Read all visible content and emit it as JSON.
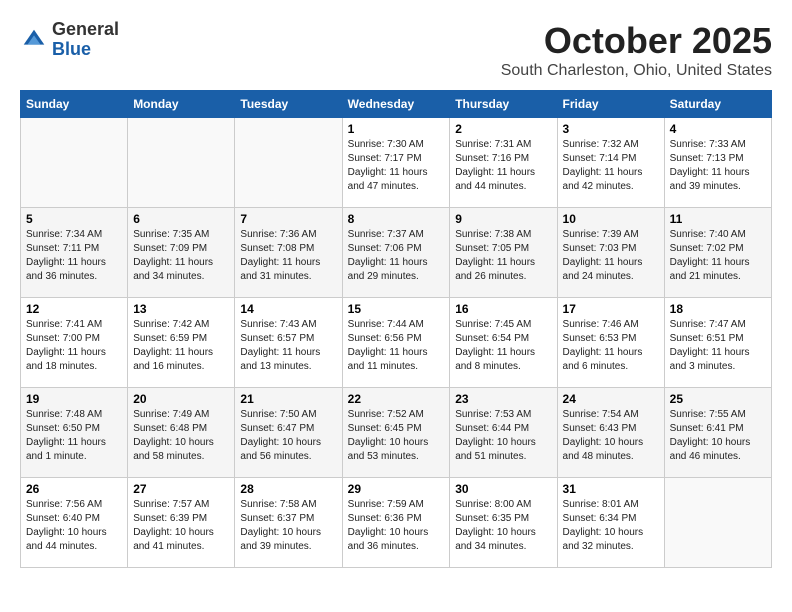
{
  "header": {
    "logo_line1": "General",
    "logo_line2": "Blue",
    "month": "October 2025",
    "location": "South Charleston, Ohio, United States"
  },
  "columns": [
    "Sunday",
    "Monday",
    "Tuesday",
    "Wednesday",
    "Thursday",
    "Friday",
    "Saturday"
  ],
  "weeks": [
    [
      {
        "day": "",
        "info": ""
      },
      {
        "day": "",
        "info": ""
      },
      {
        "day": "",
        "info": ""
      },
      {
        "day": "1",
        "info": "Sunrise: 7:30 AM\nSunset: 7:17 PM\nDaylight: 11 hours and 47 minutes."
      },
      {
        "day": "2",
        "info": "Sunrise: 7:31 AM\nSunset: 7:16 PM\nDaylight: 11 hours and 44 minutes."
      },
      {
        "day": "3",
        "info": "Sunrise: 7:32 AM\nSunset: 7:14 PM\nDaylight: 11 hours and 42 minutes."
      },
      {
        "day": "4",
        "info": "Sunrise: 7:33 AM\nSunset: 7:13 PM\nDaylight: 11 hours and 39 minutes."
      }
    ],
    [
      {
        "day": "5",
        "info": "Sunrise: 7:34 AM\nSunset: 7:11 PM\nDaylight: 11 hours and 36 minutes."
      },
      {
        "day": "6",
        "info": "Sunrise: 7:35 AM\nSunset: 7:09 PM\nDaylight: 11 hours and 34 minutes."
      },
      {
        "day": "7",
        "info": "Sunrise: 7:36 AM\nSunset: 7:08 PM\nDaylight: 11 hours and 31 minutes."
      },
      {
        "day": "8",
        "info": "Sunrise: 7:37 AM\nSunset: 7:06 PM\nDaylight: 11 hours and 29 minutes."
      },
      {
        "day": "9",
        "info": "Sunrise: 7:38 AM\nSunset: 7:05 PM\nDaylight: 11 hours and 26 minutes."
      },
      {
        "day": "10",
        "info": "Sunrise: 7:39 AM\nSunset: 7:03 PM\nDaylight: 11 hours and 24 minutes."
      },
      {
        "day": "11",
        "info": "Sunrise: 7:40 AM\nSunset: 7:02 PM\nDaylight: 11 hours and 21 minutes."
      }
    ],
    [
      {
        "day": "12",
        "info": "Sunrise: 7:41 AM\nSunset: 7:00 PM\nDaylight: 11 hours and 18 minutes."
      },
      {
        "day": "13",
        "info": "Sunrise: 7:42 AM\nSunset: 6:59 PM\nDaylight: 11 hours and 16 minutes."
      },
      {
        "day": "14",
        "info": "Sunrise: 7:43 AM\nSunset: 6:57 PM\nDaylight: 11 hours and 13 minutes."
      },
      {
        "day": "15",
        "info": "Sunrise: 7:44 AM\nSunset: 6:56 PM\nDaylight: 11 hours and 11 minutes."
      },
      {
        "day": "16",
        "info": "Sunrise: 7:45 AM\nSunset: 6:54 PM\nDaylight: 11 hours and 8 minutes."
      },
      {
        "day": "17",
        "info": "Sunrise: 7:46 AM\nSunset: 6:53 PM\nDaylight: 11 hours and 6 minutes."
      },
      {
        "day": "18",
        "info": "Sunrise: 7:47 AM\nSunset: 6:51 PM\nDaylight: 11 hours and 3 minutes."
      }
    ],
    [
      {
        "day": "19",
        "info": "Sunrise: 7:48 AM\nSunset: 6:50 PM\nDaylight: 11 hours and 1 minute."
      },
      {
        "day": "20",
        "info": "Sunrise: 7:49 AM\nSunset: 6:48 PM\nDaylight: 10 hours and 58 minutes."
      },
      {
        "day": "21",
        "info": "Sunrise: 7:50 AM\nSunset: 6:47 PM\nDaylight: 10 hours and 56 minutes."
      },
      {
        "day": "22",
        "info": "Sunrise: 7:52 AM\nSunset: 6:45 PM\nDaylight: 10 hours and 53 minutes."
      },
      {
        "day": "23",
        "info": "Sunrise: 7:53 AM\nSunset: 6:44 PM\nDaylight: 10 hours and 51 minutes."
      },
      {
        "day": "24",
        "info": "Sunrise: 7:54 AM\nSunset: 6:43 PM\nDaylight: 10 hours and 48 minutes."
      },
      {
        "day": "25",
        "info": "Sunrise: 7:55 AM\nSunset: 6:41 PM\nDaylight: 10 hours and 46 minutes."
      }
    ],
    [
      {
        "day": "26",
        "info": "Sunrise: 7:56 AM\nSunset: 6:40 PM\nDaylight: 10 hours and 44 minutes."
      },
      {
        "day": "27",
        "info": "Sunrise: 7:57 AM\nSunset: 6:39 PM\nDaylight: 10 hours and 41 minutes."
      },
      {
        "day": "28",
        "info": "Sunrise: 7:58 AM\nSunset: 6:37 PM\nDaylight: 10 hours and 39 minutes."
      },
      {
        "day": "29",
        "info": "Sunrise: 7:59 AM\nSunset: 6:36 PM\nDaylight: 10 hours and 36 minutes."
      },
      {
        "day": "30",
        "info": "Sunrise: 8:00 AM\nSunset: 6:35 PM\nDaylight: 10 hours and 34 minutes."
      },
      {
        "day": "31",
        "info": "Sunrise: 8:01 AM\nSunset: 6:34 PM\nDaylight: 10 hours and 32 minutes."
      },
      {
        "day": "",
        "info": ""
      }
    ]
  ]
}
